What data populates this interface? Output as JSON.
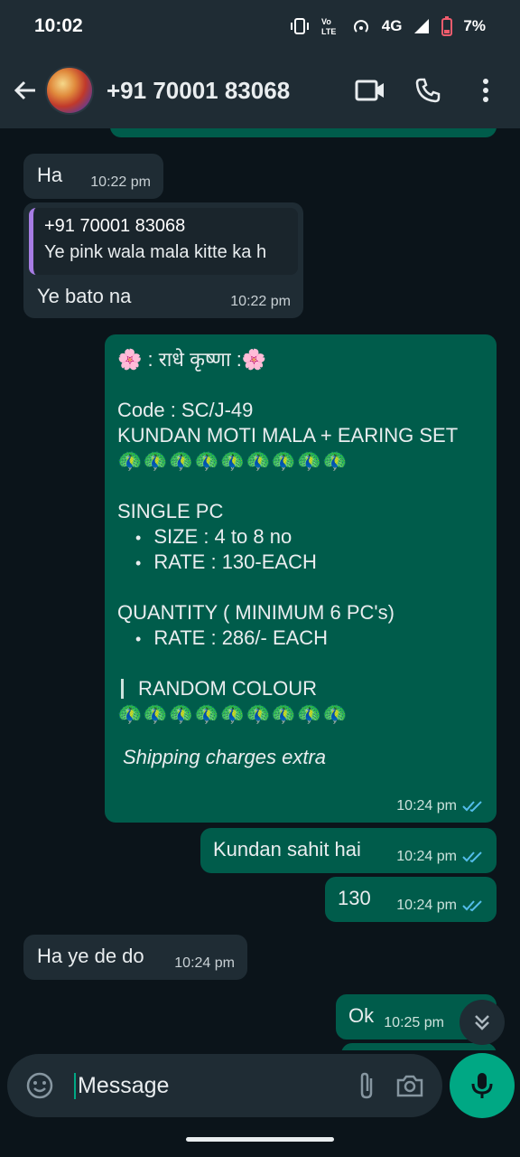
{
  "status_bar": {
    "time": "10:02",
    "network": "4G",
    "battery": "7%"
  },
  "header": {
    "contact_name": "+91 70001 83068",
    "icons": [
      "back-arrow-icon",
      "video-call-icon",
      "voice-call-icon",
      "more-options-icon"
    ]
  },
  "messages": [
    {
      "direction": "in",
      "text": "Ha",
      "time": "10:22 pm"
    },
    {
      "direction": "in",
      "quote_author": "+91 70001 83068",
      "quote_text": "Ye pink wala mala kitte ka h",
      "text": "Ye bato na",
      "time": "10:22 pm"
    },
    {
      "direction": "out",
      "lines": [
        "🌸 : राधे कृष्णा :🌸",
        "Code : SC/J-49",
        "KUNDAN MOTI MALA + EARING SET",
        "🦚🦚🦚🦚🦚🦚🦚🦚🦚",
        "SINGLE PC",
        "SIZE :  4 to 8 no",
        "RATE : 130-EACH",
        "QUANTITY ( MINIMUM 6 PC's)",
        "RATE : 286/- EACH",
        "RANDOM COLOUR",
        "🦚🦚🦚🦚🦚🦚🦚🦚🦚",
        "Shipping charges extra"
      ],
      "time": "10:24 pm"
    },
    {
      "direction": "out",
      "text": "Kundan sahit hai",
      "time": "10:24 pm"
    },
    {
      "direction": "out",
      "text": "130",
      "time": "10:24 pm"
    },
    {
      "direction": "in",
      "text": "Ha ye de do",
      "time": "10:24 pm"
    },
    {
      "direction": "out",
      "text": "Ok",
      "time": "10:25 pm"
    }
  ],
  "composer": {
    "placeholder": "Message"
  },
  "colors": {
    "background": "#0b141a",
    "incoming_bubble": "#1f2c34",
    "outgoing_bubble": "#005c4b",
    "accent": "#00a884",
    "read_ticks": "#53bdeb"
  }
}
